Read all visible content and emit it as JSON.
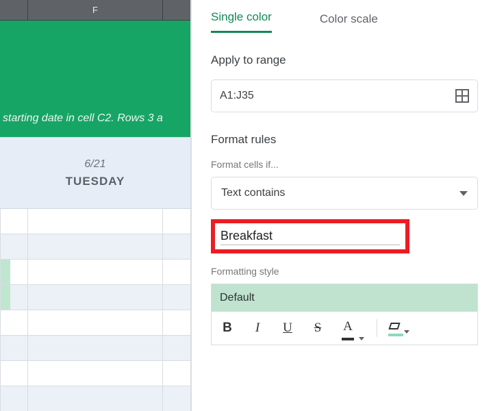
{
  "sheet": {
    "column_letter": "F",
    "banner_text": "starting date in cell C2. Rows 3 a",
    "day": {
      "date": "6/21",
      "dow": "TUESDAY"
    }
  },
  "panel": {
    "tabs": {
      "single": "Single color",
      "scale": "Color scale"
    },
    "apply_label": "Apply to range",
    "range": "A1:J35",
    "rules_label": "Format rules",
    "cells_if_label": "Format cells if...",
    "condition": "Text contains",
    "value": "Breakfast",
    "style_label": "Formatting style",
    "style_name": "Default",
    "buttons": {
      "bold": "B",
      "italic": "I",
      "underline": "U",
      "strike": "S",
      "textcolor": "A"
    }
  }
}
